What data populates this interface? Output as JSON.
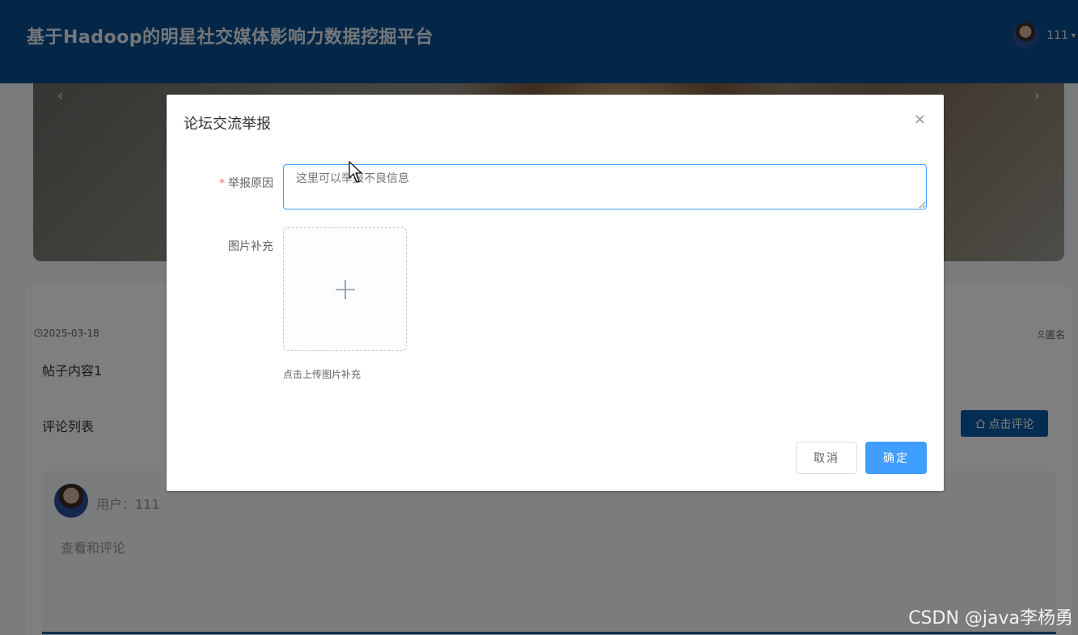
{
  "header": {
    "title": "基于Hadoop的明星社交媒体影响力数据挖掘平台",
    "user_name": "111",
    "caret": "▾"
  },
  "banner": {
    "prev_icon": "‹",
    "next_icon": "›"
  },
  "post": {
    "date": "2025-03-18",
    "author": "匿名",
    "content": "帖子内容1"
  },
  "comments": {
    "title": "评论列表",
    "button_label": "点击评论",
    "items": [
      {
        "user": "用户：111",
        "text": "查看和评论"
      }
    ]
  },
  "dialog": {
    "title": "论坛交流举报",
    "close_icon": "×",
    "reason_label": "举报原因",
    "required_mark": "*",
    "reason_placeholder": "这里可以举报不良信息",
    "image_label": "图片补充",
    "upload_tip": "点击上传图片补充",
    "cancel_label": "取消",
    "confirm_label": "确定"
  },
  "icons": {
    "clock": "clock-icon",
    "user": "user-icon",
    "home": "home-icon",
    "plus": "plus-icon",
    "close": "close-icon"
  },
  "colors": {
    "header_bg": "#0a4f8e",
    "primary": "#409eff",
    "comment_button": "#0a5aa8",
    "required": "#f56c6c"
  },
  "watermark": "CSDN @java李杨勇"
}
